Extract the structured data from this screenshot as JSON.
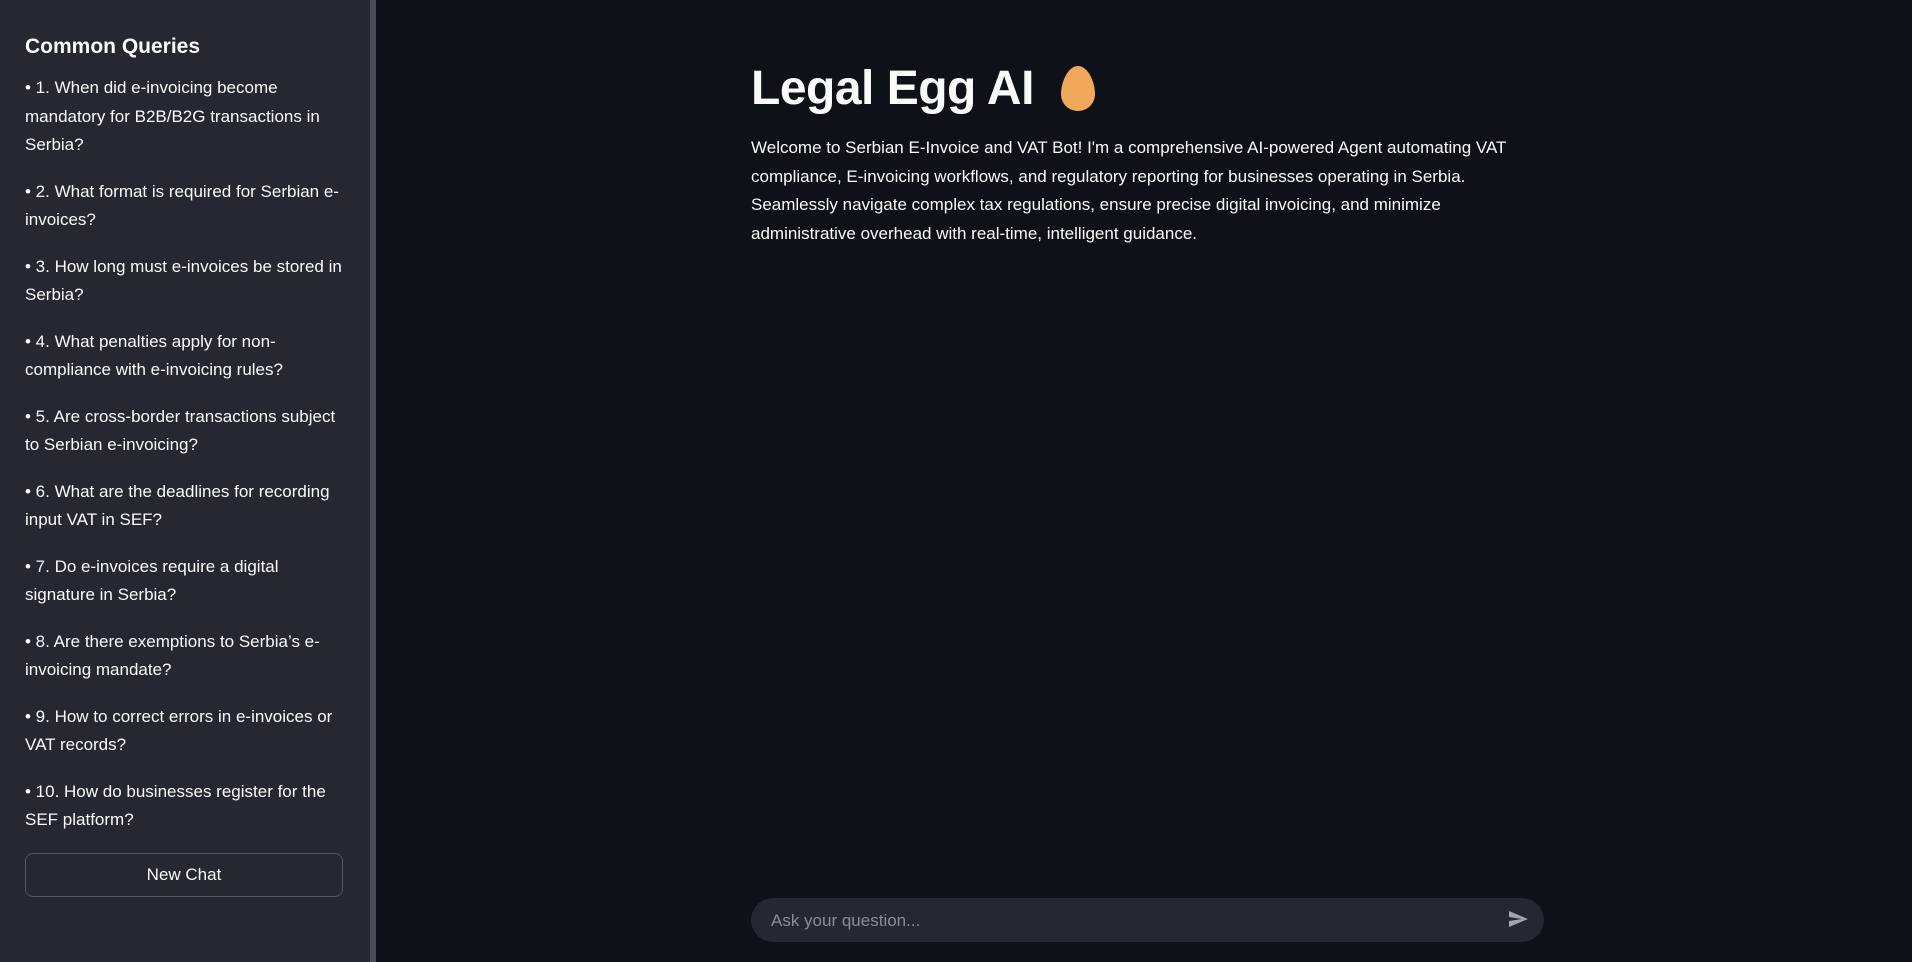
{
  "sidebar": {
    "title": "Common Queries",
    "queries": [
      "• 1. When did e-invoicing become mandatory for B2B/B2G transactions in Serbia?",
      "• 2. What format is required for Serbian e-invoices?",
      "• 3. How long must e-invoices be stored in Serbia?",
      "• 4. What penalties apply for non-compliance with e-invoicing rules?",
      "• 5. Are cross-border transactions subject to Serbian e-invoicing?",
      "• 6. What are the deadlines for recording input VAT in SEF?",
      "• 7. Do e-invoices require a digital signature in Serbia?",
      "• 8. Are there exemptions to Serbia’s e-invoicing mandate?",
      "• 9. How to correct errors in e-invoices or VAT records?",
      "• 10. How do businesses register for the SEF platform?"
    ],
    "new_chat_label": "New Chat"
  },
  "main": {
    "title": "Legal Egg AI",
    "title_icon": "egg-icon",
    "welcome": "Welcome to Serbian E-Invoice and VAT Bot! I'm a comprehensive AI-powered Agent automating VAT compliance, E-invoicing workflows, and regulatory reporting for businesses operating in Serbia. Seamlessly navigate complex tax regulations, ensure precise digital invoicing, and minimize administrative overhead with real-time, intelligent guidance."
  },
  "chat": {
    "placeholder": "Ask your question...",
    "send_icon": "send-icon"
  },
  "colors": {
    "background": "#0e1117",
    "sidebar": "#262730",
    "egg": "#f2a85b",
    "text": "#fafafa"
  }
}
